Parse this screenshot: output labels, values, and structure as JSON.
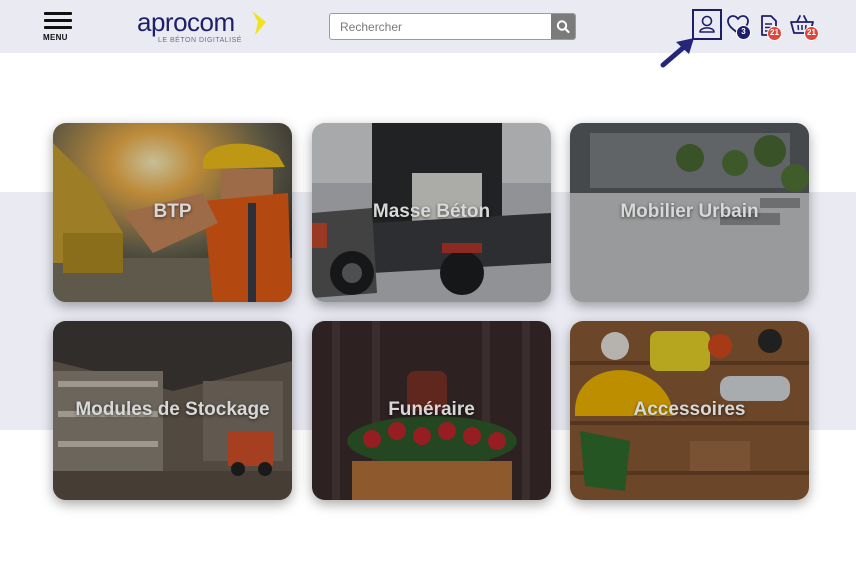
{
  "header": {
    "menu_label": "MENU",
    "logo": {
      "word": "aprocom",
      "tagline": "LE BÉTON DIGITALISÉ"
    },
    "search": {
      "placeholder": "Rechercher"
    },
    "icons": {
      "account": "user-icon",
      "wishlist": {
        "icon": "heart-icon",
        "count": "3"
      },
      "quotes": {
        "icon": "document-icon",
        "count": "21"
      },
      "cart": {
        "icon": "basket-icon",
        "count": "21"
      }
    }
  },
  "categories": [
    {
      "label": "BTP"
    },
    {
      "label": "Masse Béton"
    },
    {
      "label": "Mobilier Urbain"
    },
    {
      "label": "Modules de Stockage"
    },
    {
      "label": "Funéraire"
    },
    {
      "label": "Accessoires"
    }
  ],
  "colors": {
    "brand_navy": "#1e1f6b",
    "brand_yellow": "#f2e21a",
    "header_bg": "#e9eaf2",
    "badge_navy": "#1e1f6b",
    "badge_red": "#e0463c"
  }
}
